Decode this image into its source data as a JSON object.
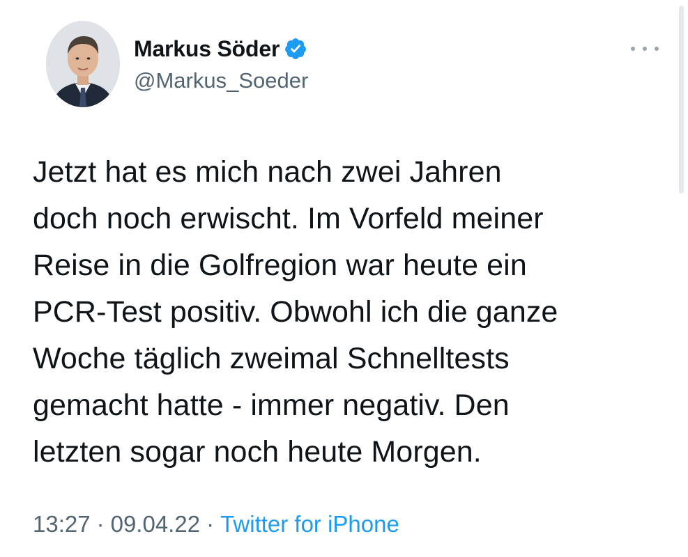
{
  "tweet": {
    "author": {
      "display_name": "Markus Söder",
      "handle": "@Markus_Soeder",
      "verified": true,
      "avatar_icon": "profile-photo",
      "verified_icon": "verified-badge-icon"
    },
    "more_icon": "more-options-icon",
    "text": "Jetzt hat es mich nach zwei Jahren\ndoch noch erwischt. Im Vorfeld meiner\nReise in die Golfregion war heute ein\nPCR-Test positiv. Obwohl ich die ganze\nWoche täglich zweimal Schnelltests\ngemacht hatte - immer negativ. Den\nletzten sogar noch heute Morgen.",
    "time": "13:27",
    "date": "09.04.22",
    "separator": "·",
    "source": "Twitter for iPhone"
  },
  "colors": {
    "accent": "#1d9bf0",
    "text": "#0f1419",
    "muted": "#536471"
  }
}
